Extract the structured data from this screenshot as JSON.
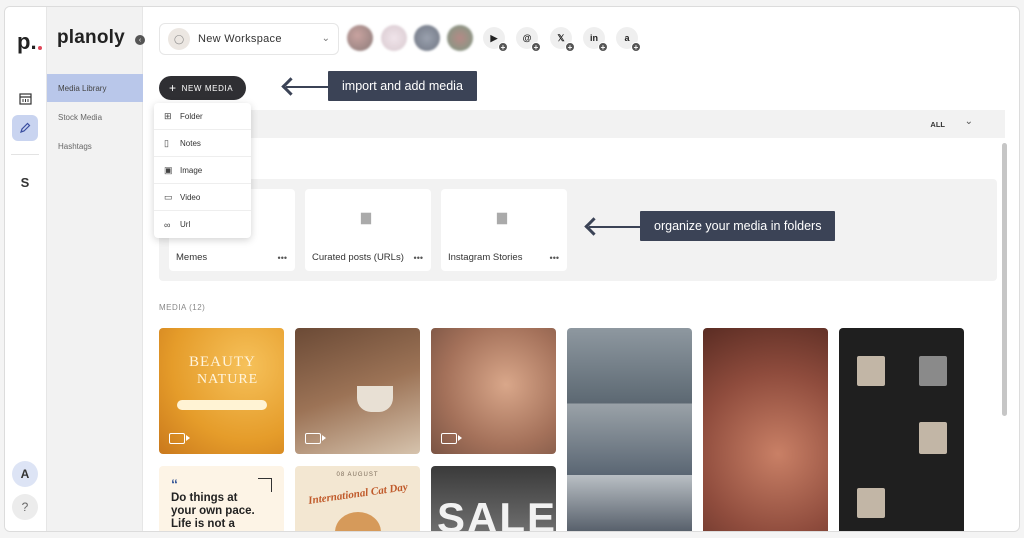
{
  "brand": {
    "rail_logo": "p.",
    "name": "planoly"
  },
  "sidebar": {
    "items": [
      {
        "label": "Media Library",
        "active": true
      },
      {
        "label": "Stock Media",
        "active": false
      },
      {
        "label": "Hashtags",
        "active": false
      }
    ]
  },
  "rail": {
    "avatar_letter": "A",
    "help": "?",
    "s_logo": "S"
  },
  "workspace": {
    "label": "New Workspace"
  },
  "social": [
    {
      "icon": "youtube-icon",
      "glyph": "▶"
    },
    {
      "icon": "threads-icon",
      "glyph": "@"
    },
    {
      "icon": "x-icon",
      "glyph": "𝕏"
    },
    {
      "icon": "linkedin-icon",
      "glyph": "in"
    },
    {
      "icon": "amazon-icon",
      "glyph": "a"
    }
  ],
  "new_media": {
    "label": "NEW MEDIA",
    "menu": [
      {
        "label": "Folder",
        "icon": "folder-plus-icon"
      },
      {
        "label": "Notes",
        "icon": "note-icon"
      },
      {
        "label": "Image",
        "icon": "image-icon"
      },
      {
        "label": "Video",
        "icon": "video-icon"
      },
      {
        "label": "Url",
        "icon": "link-icon"
      }
    ]
  },
  "callouts": {
    "import": "import and add media",
    "organize": "organize your media in folders"
  },
  "filter": {
    "label": "ALL"
  },
  "folders": [
    {
      "name": "Memes"
    },
    {
      "name": "Curated posts (URLs)"
    },
    {
      "name": "Instagram Stories"
    }
  ],
  "media": {
    "heading": "MEDIA (12)",
    "tiles": [
      {
        "text_top": "BEAUTY",
        "text_bot": "NATURE",
        "video": true
      },
      {
        "video": true
      },
      {
        "video": true
      },
      {
        "video": false
      },
      {
        "video": false
      },
      {
        "video": false
      },
      {
        "quote": "Do things at your own pace. Life is not a",
        "video": false
      },
      {
        "date": "08 AUGUST",
        "title": "International Cat Day",
        "video": false
      },
      {
        "big": "SALE",
        "video": false
      }
    ]
  }
}
